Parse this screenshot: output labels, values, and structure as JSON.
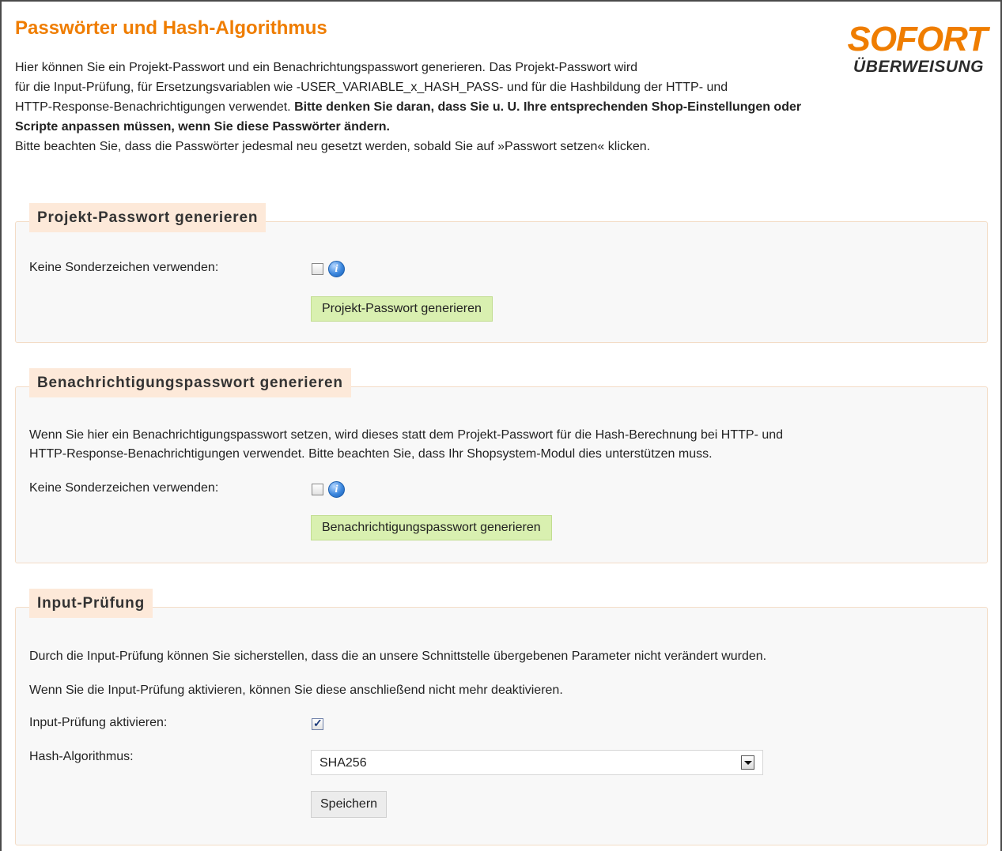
{
  "page": {
    "title": "Passwörter und Hash-Algorithmus",
    "logo": {
      "line1": "SOFORT",
      "line2": "ÜBERWEISUNG"
    },
    "intro": {
      "line1": "Hier können Sie ein Projekt-Passwort und ein Benachrichtungspasswort generieren. Das Projekt-Passwort wird",
      "line2": "für die Input-Prüfung, für Ersetzungsvariablen wie -USER_VARIABLE_x_HASH_PASS- und für die Hashbildung der HTTP- und",
      "line3_normal": "HTTP-Response-Benachrichtigungen verwendet. ",
      "line3_bold": "Bitte denken Sie daran, dass Sie u. U. Ihre entsprechenden Shop-Einstellungen oder",
      "line4_bold": "Scripte anpassen müssen, wenn Sie diese Passwörter ändern.",
      "line5": "Bitte beachten Sie, dass die Passwörter jedesmal neu gesetzt werden, sobald Sie auf »Passwort setzen« klicken."
    }
  },
  "project_section": {
    "legend": "Projekt-Passwort generieren",
    "checkbox_label": "Keine Sonderzeichen verwenden:",
    "checkbox_checked": false,
    "button_label": "Projekt-Passwort generieren"
  },
  "notification_section": {
    "legend": "Benachrichtigungspasswort generieren",
    "description_line1": "Wenn Sie hier ein Benachrichtigungspasswort setzen, wird dieses statt dem Projekt-Passwort für die Hash-Berechnung bei HTTP- und",
    "description_line2": "HTTP-Response-Benachrichtigungen verwendet. Bitte beachten Sie, dass Ihr Shopsystem-Modul dies unterstützen muss.",
    "checkbox_label": "Keine Sonderzeichen verwenden:",
    "checkbox_checked": false,
    "button_label": "Benachrichtigungspasswort generieren"
  },
  "input_section": {
    "legend": "Input-Prüfung",
    "text1": "Durch die Input-Prüfung können Sie sicherstellen, dass die an unsere Schnittstelle übergebenen Parameter nicht verändert wurden.",
    "text2": "Wenn Sie die Input-Prüfung aktivieren, können Sie diese anschließend nicht mehr deaktivieren.",
    "checkbox_label": "Input-Prüfung aktivieren:",
    "checkbox_checked": true,
    "hash_label": "Hash-Algorithmus:",
    "hash_value": "SHA256",
    "save_label": "Speichern"
  },
  "colors": {
    "title_orange": "#ef7d00",
    "legend_bg": "#fde9d9",
    "green_button": "#d9f0b0",
    "section_bg": "#f8f8f8"
  }
}
